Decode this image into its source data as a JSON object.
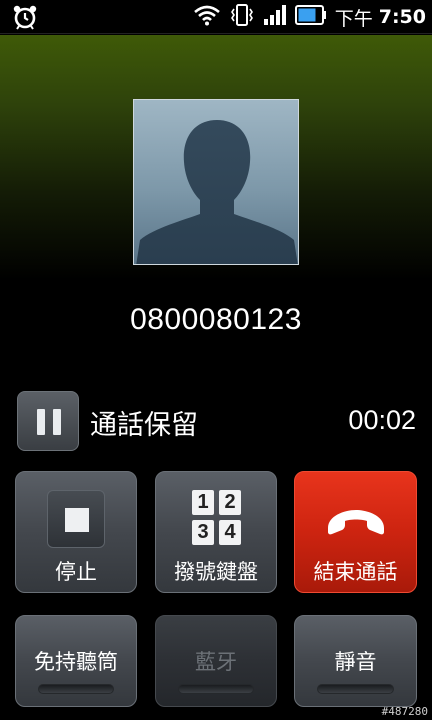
{
  "status_bar": {
    "ampm": "下午",
    "time": "7:50",
    "icons": [
      "alarm-icon",
      "wifi-icon",
      "vibrate-icon",
      "signal-icon",
      "battery-icon"
    ]
  },
  "call": {
    "number": "0800080123",
    "hold_label": "通話保留",
    "duration": "00:02"
  },
  "buttons": {
    "stop": "停止",
    "keypad": "撥號鍵盤",
    "keypad_keys": [
      "1",
      "2",
      "3",
      "4"
    ],
    "end_call": "結束通話",
    "speaker": "免持聽筒",
    "bluetooth": "藍牙",
    "mute": "靜音"
  },
  "colors": {
    "end_call": "#cd2410",
    "accent_green": "#3f5a08"
  },
  "watermark": "#487280"
}
